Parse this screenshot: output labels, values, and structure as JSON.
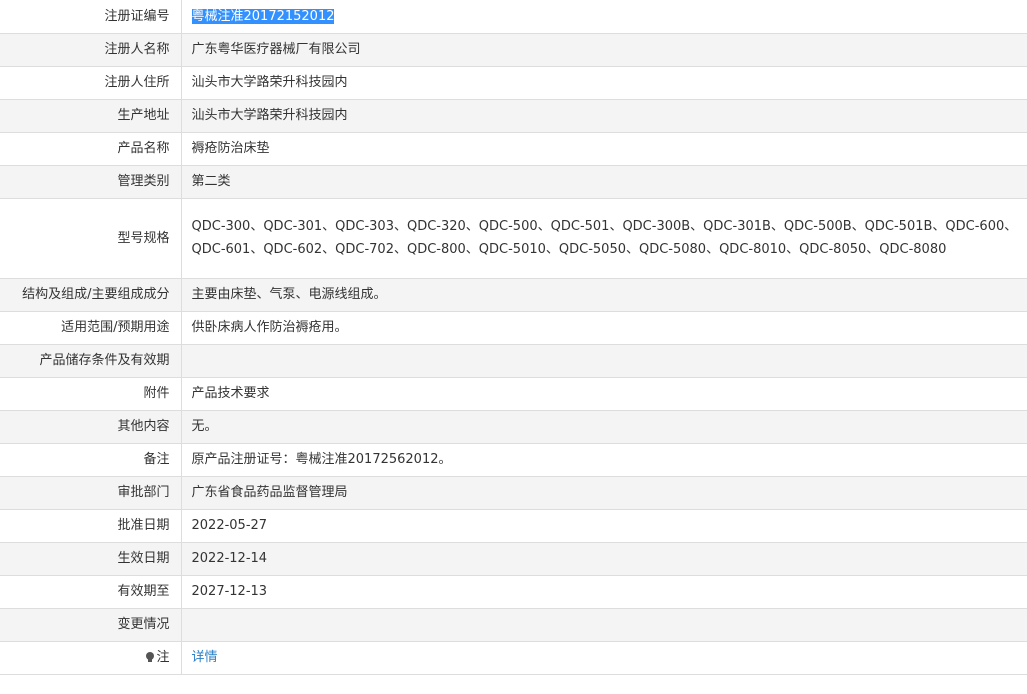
{
  "rows": [
    {
      "label": "注册证编号",
      "value": "粤械注准20172152012"
    },
    {
      "label": "注册人名称",
      "value": "广东粤华医疗器械厂有限公司"
    },
    {
      "label": "注册人住所",
      "value": "汕头市大学路荣升科技园内"
    },
    {
      "label": "生产地址",
      "value": "汕头市大学路荣升科技园内"
    },
    {
      "label": "产品名称",
      "value": "褥疮防治床垫"
    },
    {
      "label": "管理类别",
      "value": "第二类"
    },
    {
      "label": "型号规格",
      "value": "QDC-300、QDC-301、QDC-303、QDC-320、QDC-500、QDC-501、QDC-300B、QDC-301B、QDC-500B、QDC-501B、QDC-600、QDC-601、QDC-602、QDC-702、QDC-800、QDC-5010、QDC-5050、QDC-5080、QDC-8010、QDC-8050、QDC-8080"
    },
    {
      "label": "结构及组成/主要组成成分",
      "value": "主要由床垫、气泵、电源线组成。"
    },
    {
      "label": "适用范围/预期用途",
      "value": "供卧床病人作防治褥疮用。"
    },
    {
      "label": "产品储存条件及有效期",
      "value": ""
    },
    {
      "label": "附件",
      "value": "产品技术要求"
    },
    {
      "label": "其他内容",
      "value": "无。"
    },
    {
      "label": "备注",
      "value": "原产品注册证号：粤械注准20172562012。"
    },
    {
      "label": "审批部门",
      "value": "广东省食品药品监督管理局"
    },
    {
      "label": "批准日期",
      "value": "2022-05-27"
    },
    {
      "label": "生效日期",
      "value": "2022-12-14"
    },
    {
      "label": "有效期至",
      "value": "2027-12-13"
    },
    {
      "label": "变更情况",
      "value": ""
    },
    {
      "label": "注",
      "value": "详情",
      "icon": "lightbulb-icon"
    }
  ]
}
